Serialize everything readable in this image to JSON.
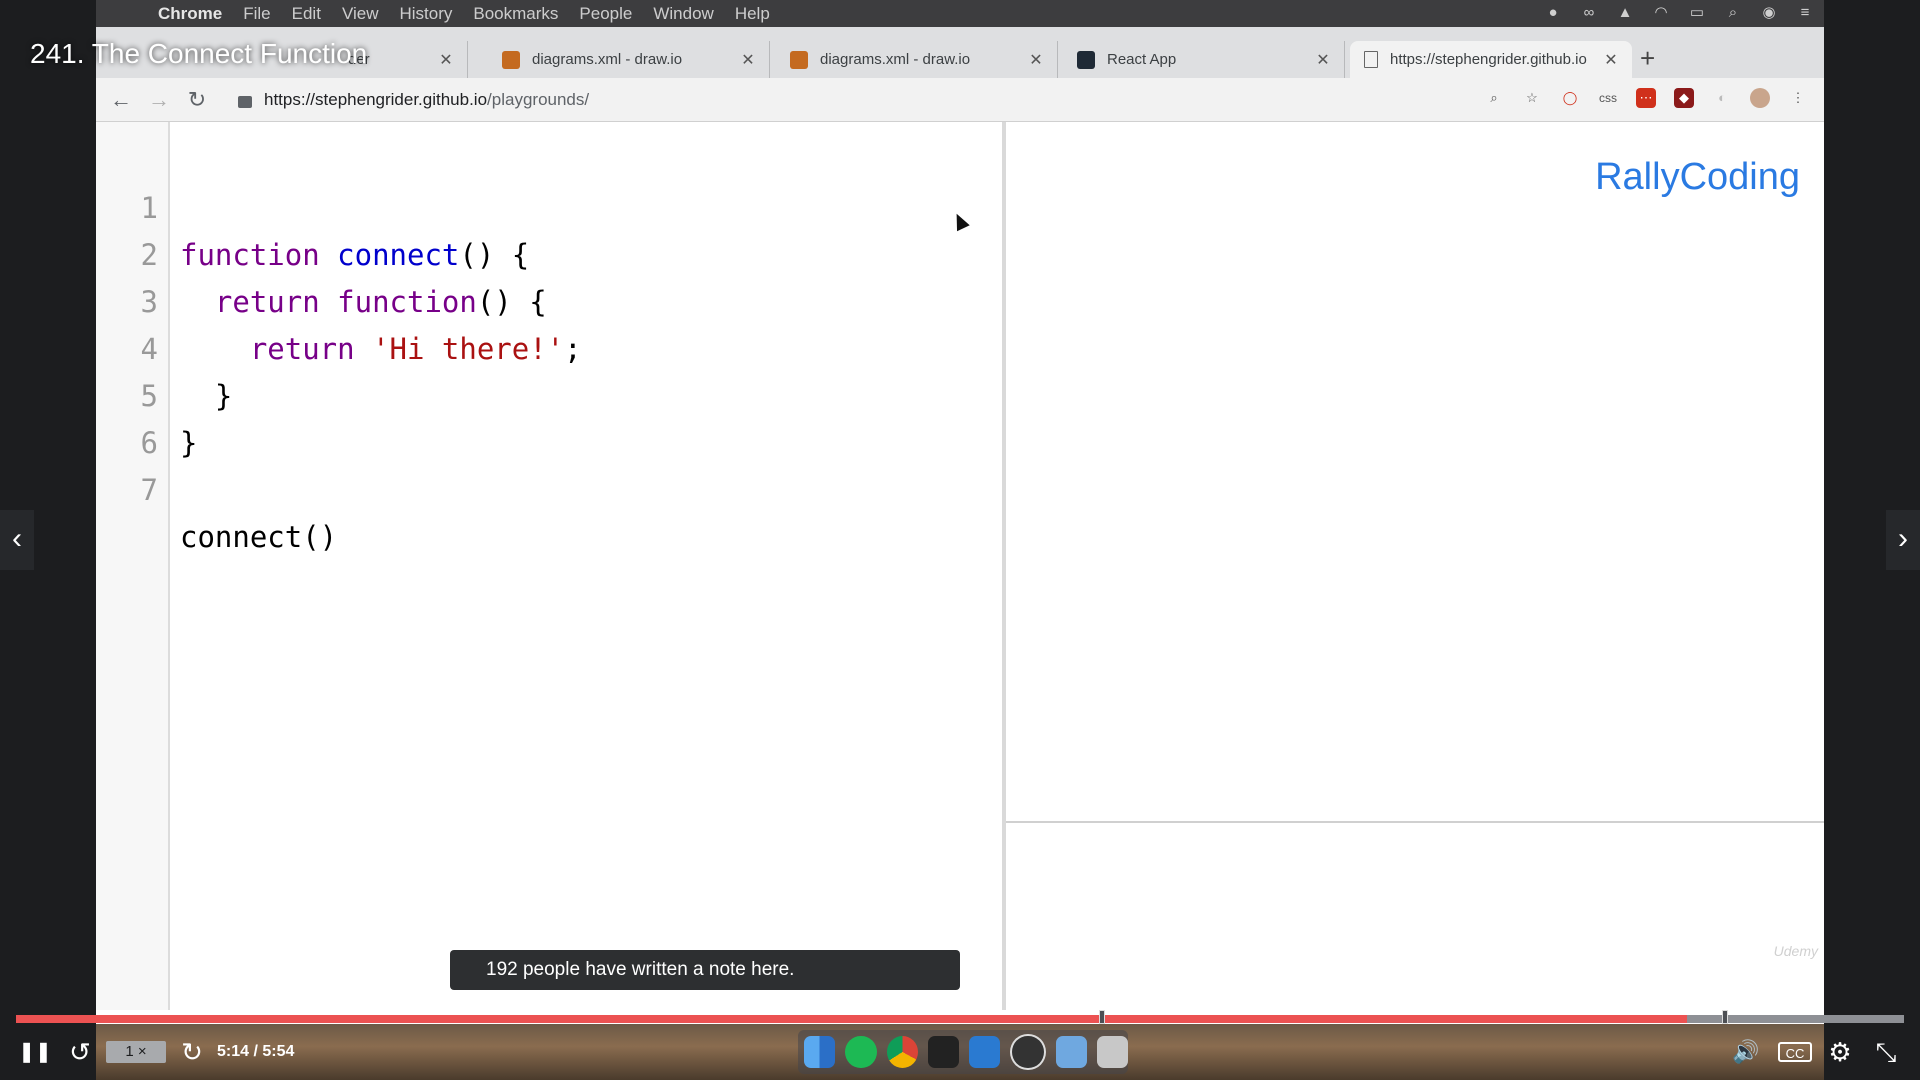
{
  "menubar": {
    "app": "Chrome",
    "items": [
      "File",
      "Edit",
      "View",
      "History",
      "Bookmarks",
      "People",
      "Window",
      "Help"
    ]
  },
  "tabs": [
    {
      "title": "der",
      "favicon_color": "#e0a040"
    },
    {
      "title": "diagrams.xml - draw.io",
      "favicon_color": "#c46a20"
    },
    {
      "title": "diagrams.xml - draw.io",
      "favicon_color": "#c46a20"
    },
    {
      "title": "React App",
      "favicon_color": "#1f2a36"
    },
    {
      "title": "https://stephengrider.github.io",
      "favicon_color": "#ffffff"
    }
  ],
  "address_bar": {
    "host": "https://stephengrider.github.io",
    "path": "/playgrounds/"
  },
  "editor": {
    "lines": [
      {
        "no": "1"
      },
      {
        "no": "2"
      },
      {
        "no": "3"
      },
      {
        "no": "4"
      },
      {
        "no": "5"
      },
      {
        "no": "6"
      },
      {
        "no": "7"
      }
    ],
    "tokens": {
      "l1_kw": "function",
      "l1_fn": "connect",
      "l1_rest": "() {",
      "l2_indent": "  ",
      "l2_kw1": "return",
      "l2_kw2": "function",
      "l2_rest": "() {",
      "l3_indent": "    ",
      "l3_kw": "return",
      "l3_str": "'Hi there!'",
      "l3_rest": ";",
      "l4_text": "  }",
      "l5_text": "}",
      "l7_text": "connect()"
    }
  },
  "preview": {
    "brand": "RallyCoding",
    "watermark": "Udemy"
  },
  "player": {
    "lecture_title": "241. The Connect Function",
    "note_toast": "192 people have written a note here.",
    "speed": "1 ×",
    "time": "5:14 / 5:54",
    "progress_fraction": 0.885,
    "bookmarks": [
      0.575,
      0.905
    ],
    "colors": {
      "progress": "#ec5252",
      "track": "#8e9095"
    }
  },
  "icons": {
    "prev": "‹",
    "next": "›",
    "pause": "❚❚",
    "rewind": "↺",
    "forward": "↻",
    "volume": "🔊",
    "captions": "CC",
    "settings": "⚙",
    "fullscreen": "⤡"
  }
}
